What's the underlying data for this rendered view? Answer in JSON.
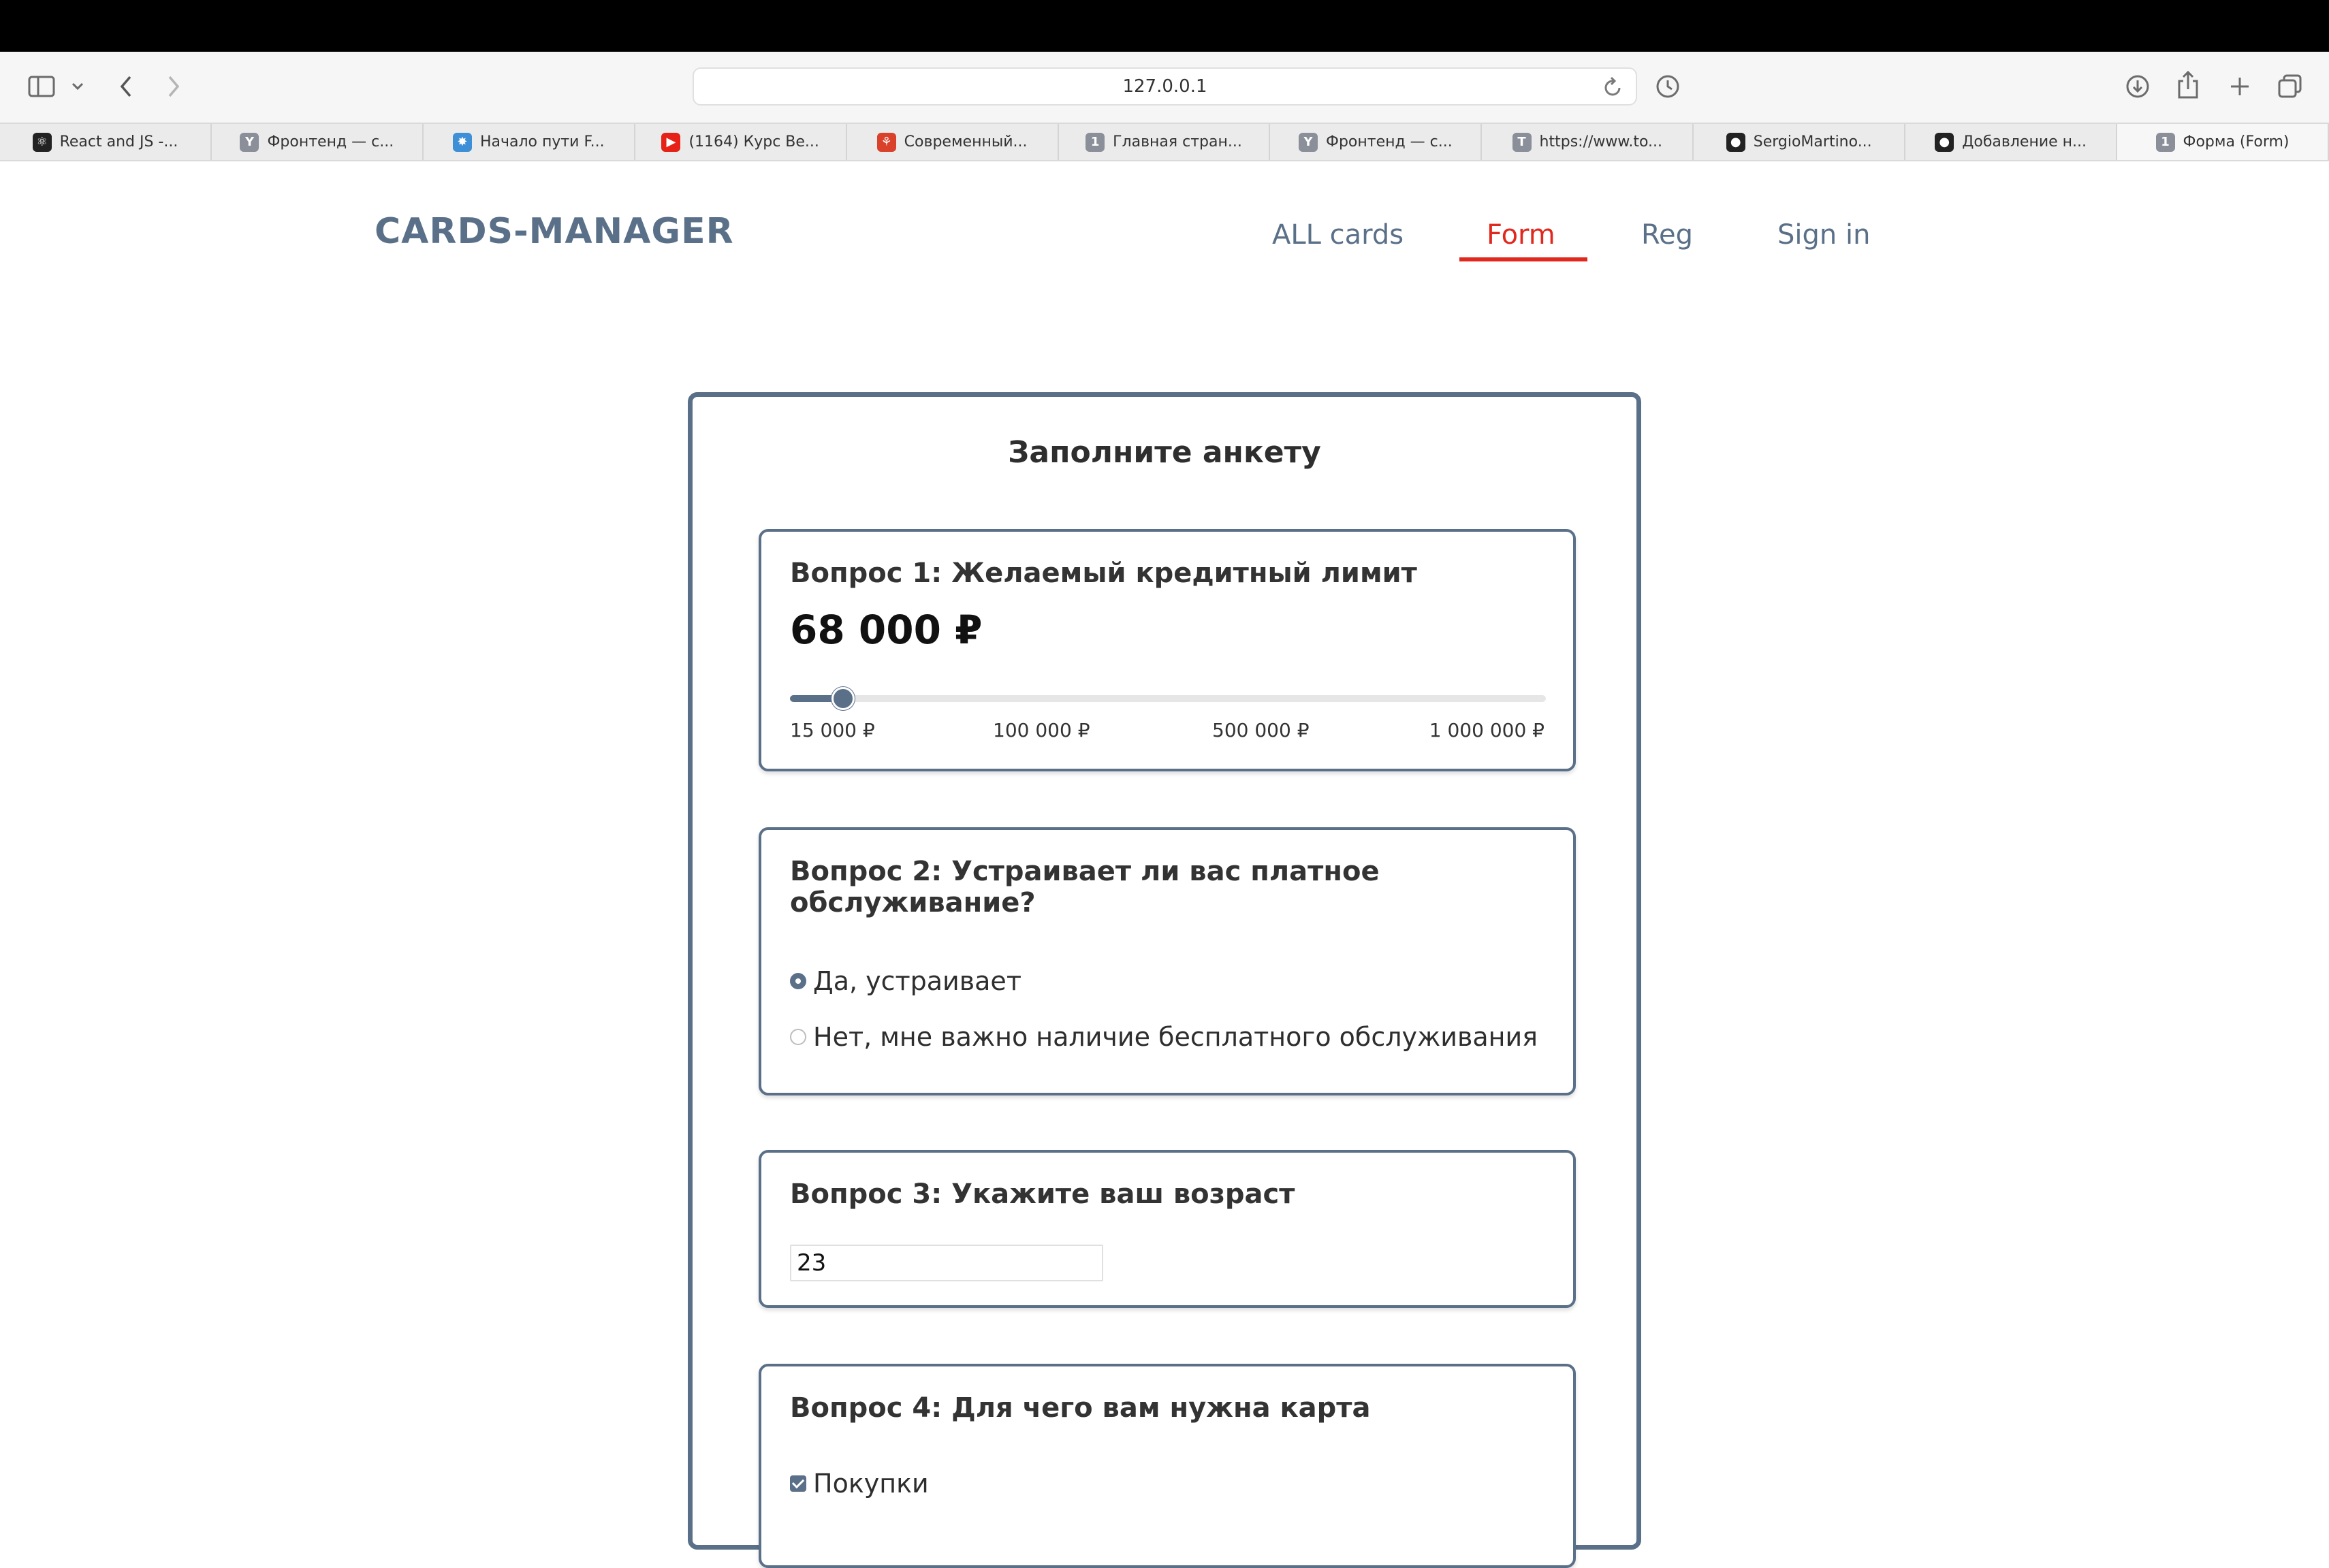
{
  "browser": {
    "url": "127.0.0.1",
    "tabs": [
      {
        "label": "React and JS -...",
        "icon": "react-icon",
        "color": "#222222",
        "glyph": "⚛"
      },
      {
        "label": "Фронтенд — с...",
        "icon": "yandex-icon",
        "color": "#8a8f99",
        "glyph": "Y"
      },
      {
        "label": "Начало пути F...",
        "icon": "starburst-icon",
        "color": "#3d8fd6",
        "glyph": "✸"
      },
      {
        "label": "(1164) Курс Ве...",
        "icon": "youtube-icon",
        "color": "#e62117",
        "glyph": "▶"
      },
      {
        "label": "Современный...",
        "icon": "figure-icon",
        "color": "#d9412b",
        "glyph": "⚘"
      },
      {
        "label": "Главная стран...",
        "icon": "one-icon",
        "color": "#8a8f99",
        "glyph": "1"
      },
      {
        "label": "Фронтенд — с...",
        "icon": "yandex-icon",
        "color": "#8a8f99",
        "glyph": "Y"
      },
      {
        "label": "https://www.to...",
        "icon": "t-icon",
        "color": "#8a8f99",
        "glyph": "T"
      },
      {
        "label": "SergioMartino...",
        "icon": "github-icon",
        "color": "#222222",
        "glyph": "●"
      },
      {
        "label": "Добавление н...",
        "icon": "github-icon",
        "color": "#222222",
        "glyph": "●"
      },
      {
        "label": "Форма (Form)",
        "icon": "one-icon",
        "color": "#8a8f99",
        "glyph": "1"
      }
    ],
    "active_tab_index": 10
  },
  "header": {
    "logo": "CARDS-MANAGER",
    "nav": [
      {
        "label": "ALL cards",
        "active": false
      },
      {
        "label": "Form",
        "active": true
      },
      {
        "label": "Reg",
        "active": false
      },
      {
        "label": "Sign in",
        "active": false
      }
    ],
    "active_color": "#e0281e",
    "brand_color": "#5a7089"
  },
  "form": {
    "title": "Заполните анкету",
    "q1": {
      "title": "Вопрос 1: Желаемый кредитный лимит",
      "amount": "68 000 ₽",
      "slider_fraction": 0.07,
      "ticks": [
        "15 000 ₽",
        "100 000 ₽",
        "500 000 ₽",
        "1 000 000 ₽"
      ]
    },
    "q2": {
      "title_line1": "Вопрос 2: Устраивает ли вас платное",
      "title_line2": "обслуживание?",
      "options": [
        {
          "label": "Да, устраивает",
          "checked": true
        },
        {
          "label": "Нет, мне важно наличие бесплатного обслуживания",
          "checked": false
        }
      ]
    },
    "q3": {
      "title": "Вопрос 3: Укажите ваш возраст",
      "value": "23"
    },
    "q4": {
      "title": "Вопрос 4: Для чего вам нужна карта",
      "options": [
        {
          "label": "Покупки",
          "checked": true
        }
      ]
    }
  }
}
